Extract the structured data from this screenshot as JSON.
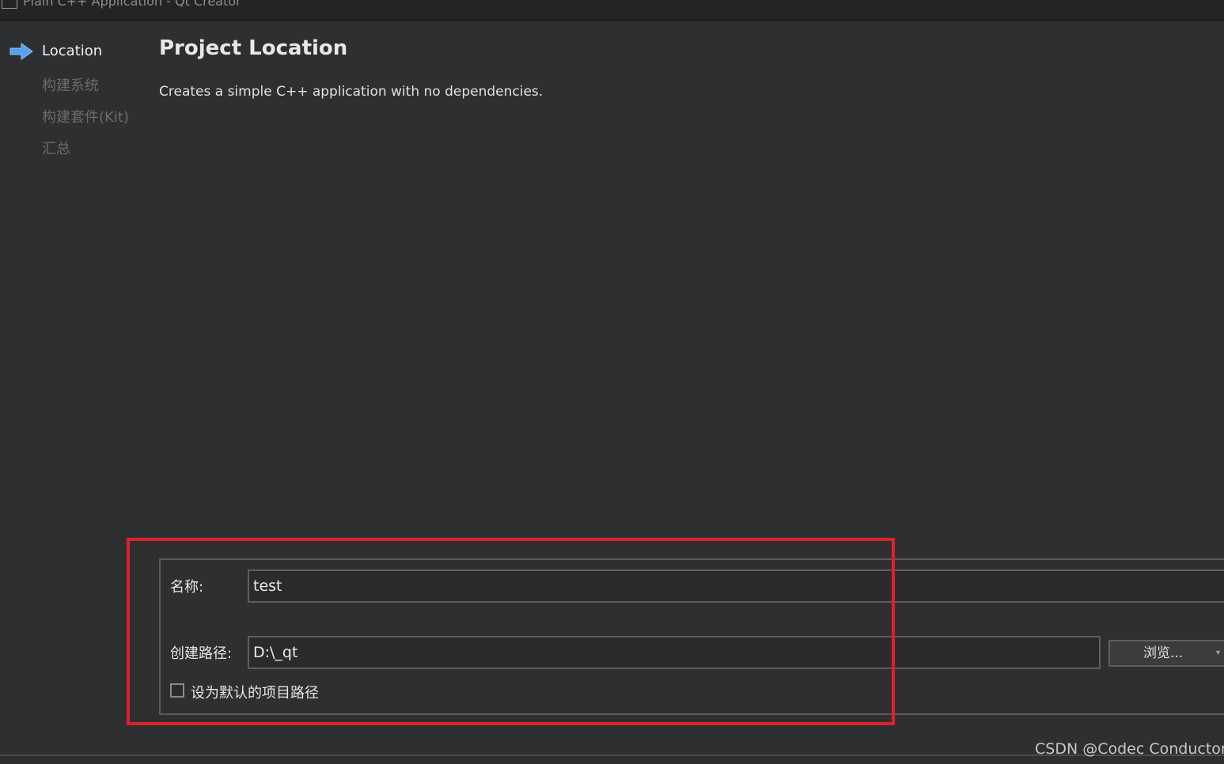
{
  "window": {
    "title": "Plain C++ Application - Qt Creator"
  },
  "sidebar": {
    "steps": [
      {
        "label": "Location",
        "active": true
      },
      {
        "label": "构建系统",
        "active": false
      },
      {
        "label": "构建套件(Kit)",
        "active": false
      },
      {
        "label": "汇总",
        "active": false
      }
    ]
  },
  "main": {
    "title": "Project Location",
    "description": "Creates a simple C++ application with no dependencies."
  },
  "form": {
    "name_label": "名称:",
    "name_value": "test",
    "path_label": "创建路径:",
    "path_value": "D:\\_qt",
    "browse_label": "浏览...",
    "default_path_label": "设为默认的项目路径",
    "default_path_checked": false
  },
  "annotation": {
    "highlight_color": "#e0202a"
  },
  "watermark": "CSDN @Codec Conductor",
  "colors": {
    "background": "#2e2f30",
    "active_arrow": "#5aa0ee"
  }
}
